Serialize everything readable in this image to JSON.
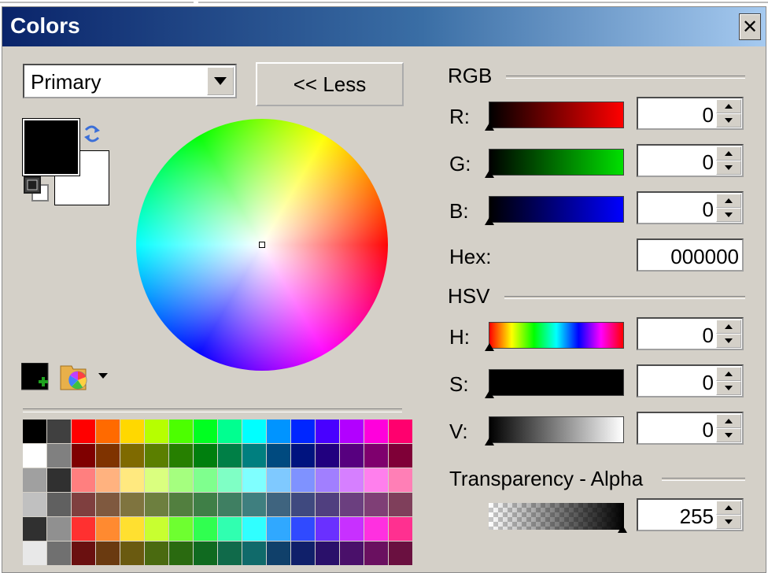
{
  "window": {
    "title": "Colors",
    "close_label": "✕"
  },
  "left": {
    "mode_dropdown": {
      "value": "Primary"
    },
    "less_button": {
      "label": "<< Less"
    },
    "primary_color": "#000000",
    "secondary_color": "#ffffff"
  },
  "palette": [
    [
      "#000000",
      "#404040",
      "#ff0000",
      "#ff6a00",
      "#ffd800",
      "#b6ff00",
      "#4cff00",
      "#00ff21",
      "#00ff90",
      "#00ffff",
      "#0094ff",
      "#0026ff",
      "#4800ff",
      "#b200ff",
      "#ff00dc",
      "#ff006e"
    ],
    [
      "#ffffff",
      "#808080",
      "#7f0000",
      "#7f3300",
      "#7f6a00",
      "#5b7f00",
      "#267f00",
      "#007f0e",
      "#007f46",
      "#007f7f",
      "#004a7f",
      "#00137f",
      "#21007f",
      "#57007f",
      "#7f006e",
      "#7f0037"
    ],
    [
      "#a0a0a0",
      "#303030",
      "#ff7f7f",
      "#ffb27f",
      "#ffe97f",
      "#daff7f",
      "#a5ff7f",
      "#7fff8e",
      "#7fffc5",
      "#7fffff",
      "#7fc9ff",
      "#7f92ff",
      "#a17fff",
      "#d67fff",
      "#ff7fed",
      "#ff7fb6"
    ],
    [
      "#c0c0c0",
      "#606060",
      "#7f3f3f",
      "#7f593f",
      "#7f743f",
      "#6d7f3f",
      "#527f3f",
      "#3f7f47",
      "#3f7f62",
      "#3f7f7f",
      "#3f647f",
      "#3f497f",
      "#503f7f",
      "#6b3f7f",
      "#7f3f76",
      "#7f3f5b"
    ],
    [
      "#303030",
      "#909090",
      "#ff3030",
      "#ff8a30",
      "#ffe030",
      "#c8ff30",
      "#6eff30",
      "#30ff50",
      "#30ffb0",
      "#30ffff",
      "#30a8ff",
      "#304aff",
      "#6a30ff",
      "#c830ff",
      "#ff30e0",
      "#ff3090"
    ],
    [
      "#e8e8e8",
      "#707070",
      "#6a1010",
      "#6a3a10",
      "#6a5a10",
      "#4a6a10",
      "#2a6a10",
      "#106a20",
      "#106a4a",
      "#106a6a",
      "#10406a",
      "#10206a",
      "#2a106a",
      "#4a106a",
      "#6a1060",
      "#6a1040"
    ]
  ],
  "rgb": {
    "title": "RGB",
    "r": {
      "label": "R:",
      "value": "0"
    },
    "g": {
      "label": "G:",
      "value": "0"
    },
    "b": {
      "label": "B:",
      "value": "0"
    },
    "hex": {
      "label": "Hex:",
      "value": "000000"
    }
  },
  "hsv": {
    "title": "HSV",
    "h": {
      "label": "H:",
      "value": "0"
    },
    "s": {
      "label": "S:",
      "value": "0"
    },
    "v": {
      "label": "V:",
      "value": "0"
    }
  },
  "alpha": {
    "title": "Transparency - Alpha",
    "value": "255"
  }
}
